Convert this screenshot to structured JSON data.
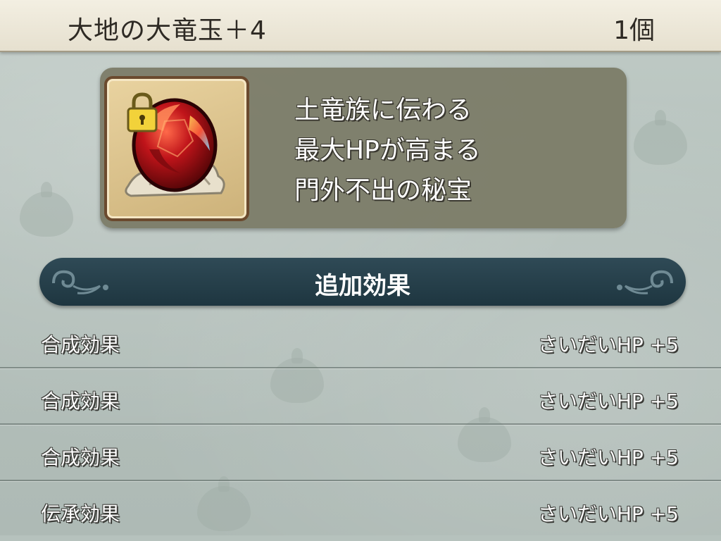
{
  "item": {
    "name": "大地の大竜玉＋4",
    "count": "1個",
    "description": [
      "土竜族に伝わる",
      "最大HPが高まる",
      "門外不出の秘宝"
    ],
    "icon": "red-dragon-orb-icon",
    "locked": true
  },
  "section": {
    "title": "追加効果"
  },
  "effects": [
    {
      "label": "合成効果",
      "value": "さいだいHP  +5"
    },
    {
      "label": "合成効果",
      "value": "さいだいHP  +5"
    },
    {
      "label": "合成効果",
      "value": "さいだいHP  +5"
    },
    {
      "label": "伝承効果",
      "value": "さいだいHP  +5"
    }
  ],
  "colors": {
    "banner": "#1e3640",
    "title_bar": "#f3efe2",
    "panel": "#7a7965",
    "orb": "#c0141a"
  }
}
